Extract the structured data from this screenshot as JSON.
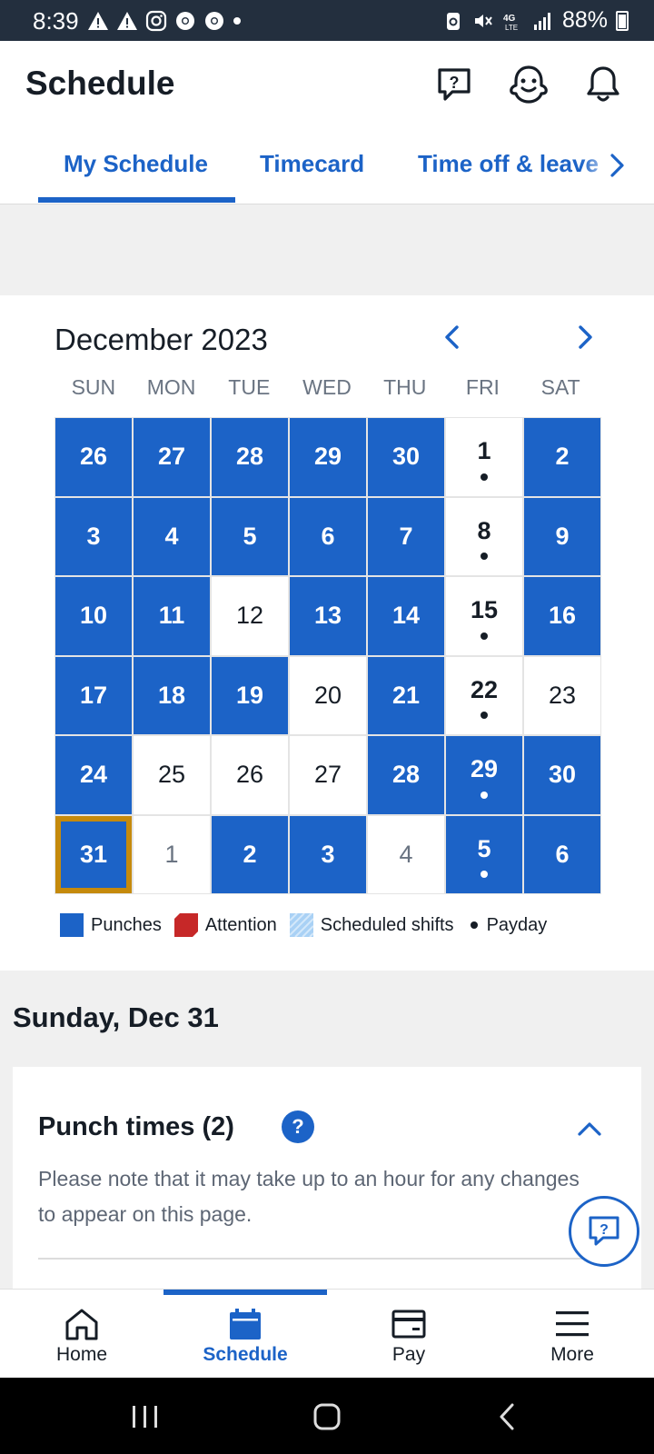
{
  "status_bar": {
    "time": "8:39",
    "battery": "88%",
    "network": "4G LTE"
  },
  "header": {
    "title": "Schedule",
    "icons": [
      "help-chat-icon",
      "ghost-bot-icon",
      "bell-icon"
    ]
  },
  "tabs": [
    {
      "label": "My Schedule",
      "active": true
    },
    {
      "label": "Timecard",
      "active": false
    },
    {
      "label": "Time off & leave",
      "active": false
    }
  ],
  "calendar": {
    "month": "December 2023",
    "weekdays": [
      "SUN",
      "MON",
      "TUE",
      "WED",
      "THU",
      "FRI",
      "SAT"
    ],
    "weeks": [
      [
        {
          "d": "26",
          "punch": true,
          "pay": false,
          "muted": false
        },
        {
          "d": "27",
          "punch": true,
          "pay": false,
          "muted": false
        },
        {
          "d": "28",
          "punch": true,
          "pay": false,
          "muted": false
        },
        {
          "d": "29",
          "punch": true,
          "pay": false,
          "muted": false
        },
        {
          "d": "30",
          "punch": true,
          "pay": false,
          "muted": false
        },
        {
          "d": "1",
          "punch": false,
          "pay": true,
          "muted": false
        },
        {
          "d": "2",
          "punch": true,
          "pay": false,
          "muted": false
        }
      ],
      [
        {
          "d": "3",
          "punch": true,
          "pay": false,
          "muted": false
        },
        {
          "d": "4",
          "punch": true,
          "pay": false,
          "muted": false
        },
        {
          "d": "5",
          "punch": true,
          "pay": false,
          "muted": false
        },
        {
          "d": "6",
          "punch": true,
          "pay": false,
          "muted": false
        },
        {
          "d": "7",
          "punch": true,
          "pay": false,
          "muted": false
        },
        {
          "d": "8",
          "punch": false,
          "pay": true,
          "muted": false
        },
        {
          "d": "9",
          "punch": true,
          "pay": false,
          "muted": false
        }
      ],
      [
        {
          "d": "10",
          "punch": true,
          "pay": false,
          "muted": false
        },
        {
          "d": "11",
          "punch": true,
          "pay": false,
          "muted": false
        },
        {
          "d": "12",
          "punch": false,
          "pay": false,
          "muted": false
        },
        {
          "d": "13",
          "punch": true,
          "pay": false,
          "muted": false
        },
        {
          "d": "14",
          "punch": true,
          "pay": false,
          "muted": false
        },
        {
          "d": "15",
          "punch": false,
          "pay": true,
          "muted": false
        },
        {
          "d": "16",
          "punch": true,
          "pay": false,
          "muted": false
        }
      ],
      [
        {
          "d": "17",
          "punch": true,
          "pay": false,
          "muted": false
        },
        {
          "d": "18",
          "punch": true,
          "pay": false,
          "muted": false
        },
        {
          "d": "19",
          "punch": true,
          "pay": false,
          "muted": false
        },
        {
          "d": "20",
          "punch": false,
          "pay": false,
          "muted": false
        },
        {
          "d": "21",
          "punch": true,
          "pay": false,
          "muted": false
        },
        {
          "d": "22",
          "punch": false,
          "pay": true,
          "muted": false
        },
        {
          "d": "23",
          "punch": false,
          "pay": false,
          "muted": false
        }
      ],
      [
        {
          "d": "24",
          "punch": true,
          "pay": false,
          "muted": false
        },
        {
          "d": "25",
          "punch": false,
          "pay": false,
          "muted": false
        },
        {
          "d": "26",
          "punch": false,
          "pay": false,
          "muted": false
        },
        {
          "d": "27",
          "punch": false,
          "pay": false,
          "muted": false
        },
        {
          "d": "28",
          "punch": true,
          "pay": false,
          "muted": false
        },
        {
          "d": "29",
          "punch": true,
          "pay": true,
          "muted": false
        },
        {
          "d": "30",
          "punch": true,
          "pay": false,
          "muted": false
        }
      ],
      [
        {
          "d": "31",
          "punch": true,
          "pay": false,
          "muted": false,
          "today": true
        },
        {
          "d": "1",
          "punch": false,
          "pay": false,
          "muted": true
        },
        {
          "d": "2",
          "punch": true,
          "pay": false,
          "muted": false
        },
        {
          "d": "3",
          "punch": true,
          "pay": false,
          "muted": false
        },
        {
          "d": "4",
          "punch": false,
          "pay": false,
          "muted": true
        },
        {
          "d": "5",
          "punch": true,
          "pay": true,
          "muted": false
        },
        {
          "d": "6",
          "punch": true,
          "pay": false,
          "muted": false
        }
      ]
    ],
    "legend": {
      "punches": "Punches",
      "attention": "Attention",
      "scheduled": "Scheduled shifts",
      "payday": "Payday"
    },
    "colors": {
      "punch": "#1c63c7",
      "attention": "#c62828",
      "scheduled": "#a9d1f5",
      "today_outline": "#c58a0c"
    }
  },
  "day_detail": {
    "title": "Sunday, Dec 31",
    "punch_title": "Punch times (2)",
    "help": "?",
    "note": "Please note that it may take up to an hour for any changes to appear on this page."
  },
  "bottom_nav": [
    {
      "label": "Home",
      "icon": "home-icon",
      "active": false
    },
    {
      "label": "Schedule",
      "icon": "calendar-icon",
      "active": true
    },
    {
      "label": "Pay",
      "icon": "wallet-icon",
      "active": false
    },
    {
      "label": "More",
      "icon": "menu-icon",
      "active": false
    }
  ]
}
